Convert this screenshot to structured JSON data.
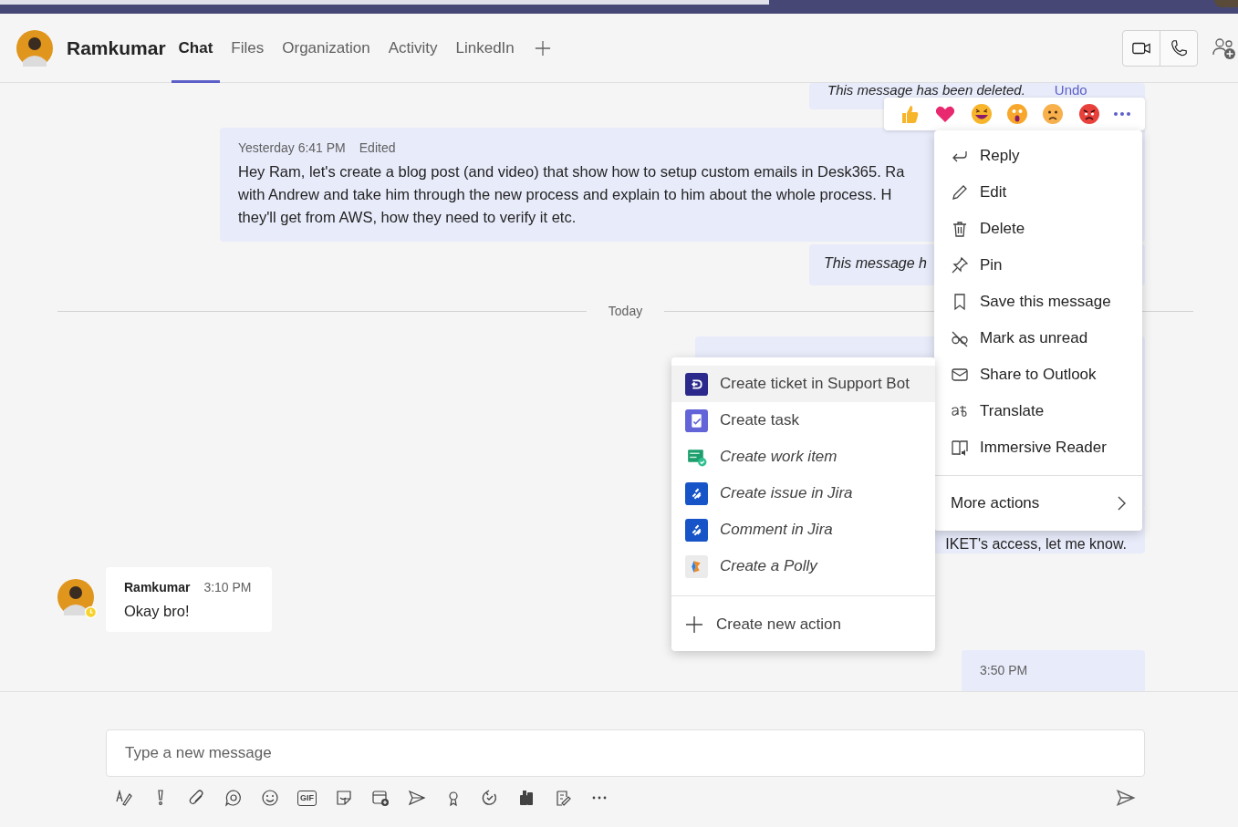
{
  "header": {
    "name": "Ramkumar",
    "tabs": [
      {
        "label": "Chat",
        "selected": true
      },
      {
        "label": "Files",
        "selected": false
      },
      {
        "label": "Organization",
        "selected": false
      },
      {
        "label": "Activity",
        "selected": false
      },
      {
        "label": "LinkedIn",
        "selected": false
      }
    ]
  },
  "chat": {
    "deleted_message": {
      "text": "This message has been deleted.",
      "action": "Undo"
    },
    "edited_message": {
      "time": "Yesterday 6:41 PM",
      "status": "Edited",
      "lines": [
        "Hey Ram, let's create a blog post (and video) that show how to setup custom emails in Desk365. Ra",
        "with Andrew and take him through the new process and explain to him about the whole process. H",
        "they'll get from AWS, how they need to verify it etc."
      ]
    },
    "deleted_message_2": {
      "text": "This message h"
    },
    "day_divider": "Today",
    "partial_message": {
      "text": "IKET's access, let me know."
    },
    "received_message": {
      "sender": "Ramkumar",
      "time": "3:10 PM",
      "text": "Okay bro!"
    },
    "partial_time": "3:50 PM"
  },
  "message_menu": {
    "items": [
      {
        "label": "Reply"
      },
      {
        "label": "Edit"
      },
      {
        "label": "Delete"
      },
      {
        "label": "Pin"
      },
      {
        "label": "Save this message"
      },
      {
        "label": "Mark as unread"
      },
      {
        "label": "Share to Outlook"
      },
      {
        "label": "Translate"
      },
      {
        "label": "Immersive Reader"
      }
    ],
    "more": "More actions"
  },
  "actions_menu": {
    "items": [
      {
        "label": "Create ticket in Support Bot",
        "italic": false,
        "selected": true
      },
      {
        "label": "Create task",
        "italic": false,
        "selected": false
      },
      {
        "label": "Create work item",
        "italic": true,
        "selected": false
      },
      {
        "label": "Create issue in Jira",
        "italic": true,
        "selected": false
      },
      {
        "label": "Comment in Jira",
        "italic": true,
        "selected": false
      },
      {
        "label": "Create a Polly",
        "italic": true,
        "selected": false
      }
    ],
    "create": "Create new action"
  },
  "compose": {
    "placeholder": "Type a new message",
    "gif": "GIF"
  }
}
